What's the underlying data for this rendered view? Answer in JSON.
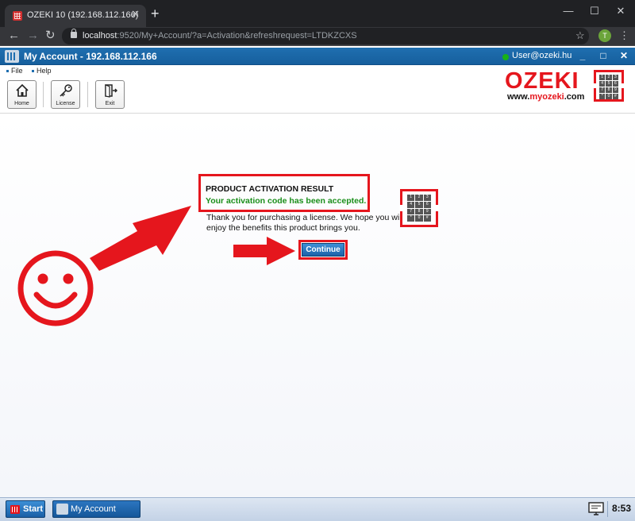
{
  "browser": {
    "tab_title": "OZEKI 10 (192.168.112.166)",
    "tab_close": "✕",
    "new_tab": "+",
    "window_controls": {
      "minimize": "—",
      "maximize": "☐",
      "close": "✕"
    },
    "nav": {
      "back": "←",
      "forward": "→",
      "reload": "↻"
    },
    "url_host": "localhost",
    "url_rest": ":9520/My+Account/?a=Activation&refreshrequest=LTDKZCXS",
    "profile_initial": "T"
  },
  "app": {
    "title": "My Account - 192.168.112.166",
    "user": "User@ozeki.hu",
    "user_status_color": "#18b218",
    "window_controls": {
      "minimize": "_",
      "maximize": "□",
      "close": "✕"
    }
  },
  "menu": {
    "items": [
      "File",
      "Help"
    ]
  },
  "toolbar": {
    "home_label": "Home",
    "license_label": "License",
    "exit_label": "Exit"
  },
  "logo": {
    "text": "OZEKI",
    "url_prefix": "www.",
    "url_accent": "myozeki",
    "url_suffix": ".com",
    "brand_color": "#e5161d",
    "keypad_keys": [
      "1",
      "2",
      "3",
      "4",
      "5",
      "6",
      "7",
      "8",
      "9",
      "*",
      "0",
      "#"
    ]
  },
  "activation": {
    "title": "PRODUCT ACTIVATION RESULT",
    "status": "Your activation code has been accepted.",
    "description": "Thank you for purchasing a license. We hope you will enjoy the benefits this product brings you.",
    "continue_label": "Continue"
  },
  "taskbar": {
    "start_label": "Start",
    "task_label": "My Account",
    "clock": "8:53"
  }
}
